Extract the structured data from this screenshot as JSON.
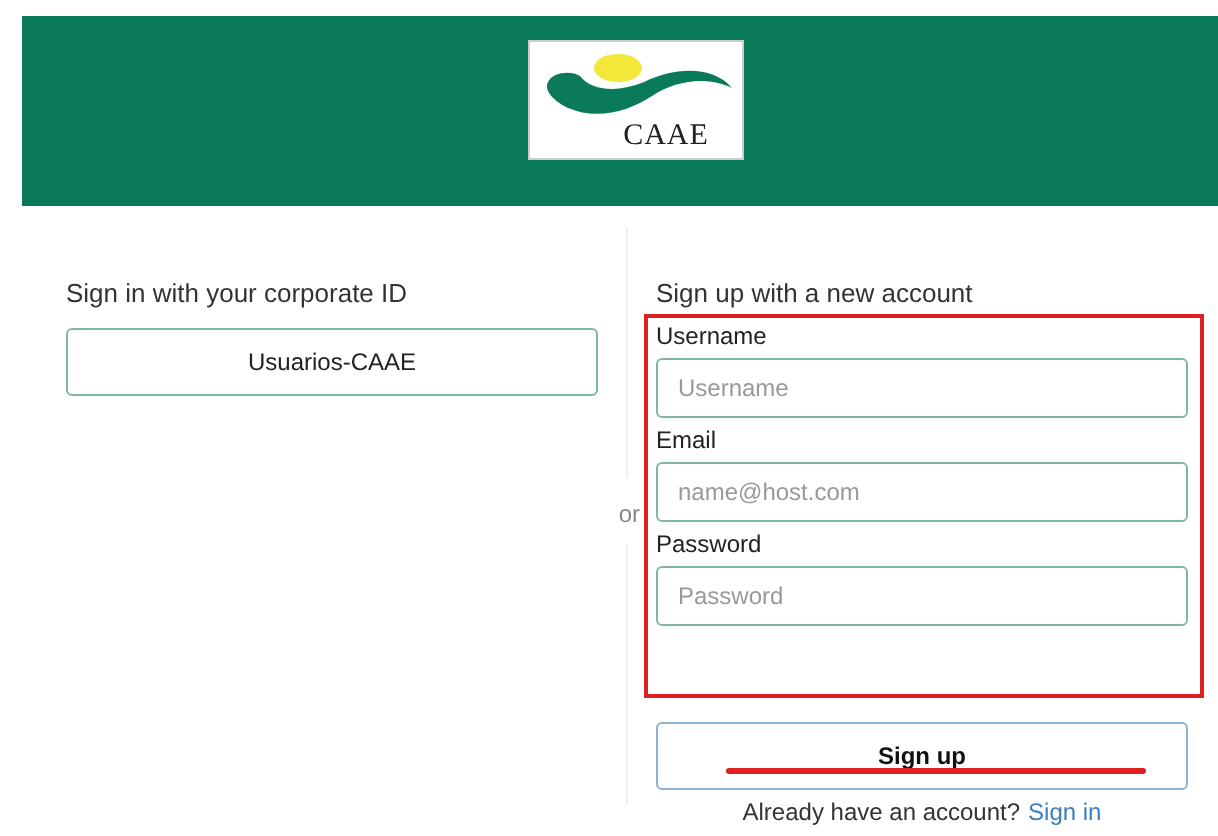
{
  "logo": {
    "text": "CAAE"
  },
  "sign_in": {
    "title": "Sign in with your corporate ID",
    "provider_button": "Usuarios-CAAE"
  },
  "separator": "or",
  "sign_up": {
    "title": "Sign up with a new account",
    "fields": [
      {
        "label": "Username",
        "placeholder": "Username"
      },
      {
        "label": "Email",
        "placeholder": "name@host.com"
      },
      {
        "label": "Password",
        "placeholder": "Password"
      }
    ],
    "button": "Sign up",
    "footer_text": "Already have an account?",
    "footer_link": "Sign in"
  }
}
